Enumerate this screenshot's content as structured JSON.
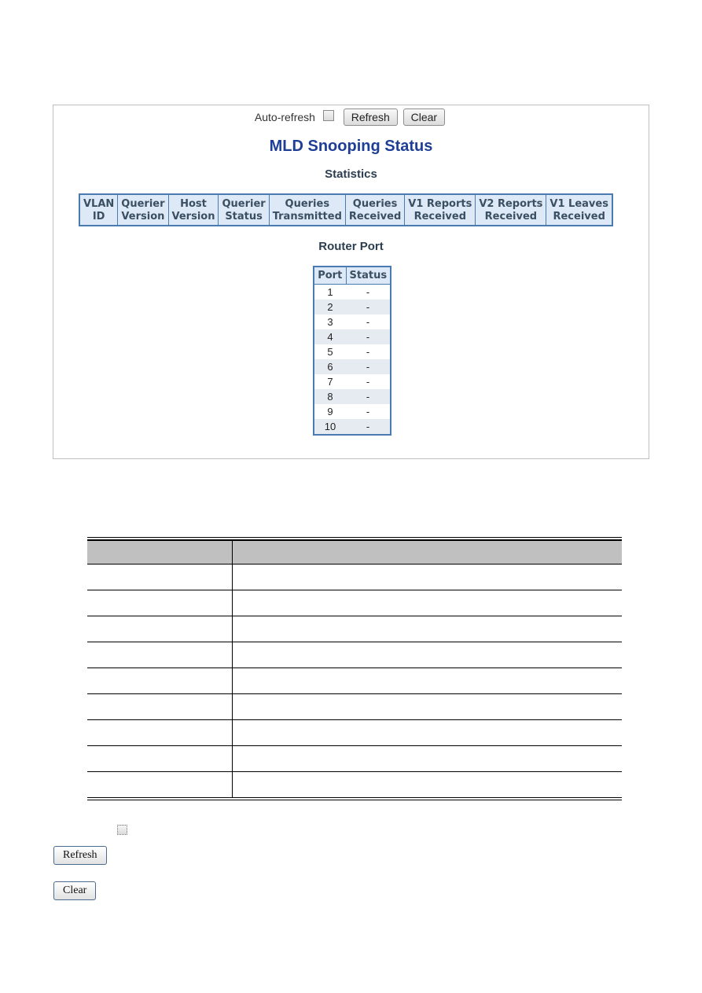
{
  "screenshot": {
    "auto_refresh_label": "Auto-refresh",
    "auto_refresh_checked": false,
    "refresh_button": "Refresh",
    "clear_button": "Clear",
    "title": "MLD Snooping Status",
    "statistics_heading": "Statistics",
    "statistics_columns": [
      [
        "VLAN",
        "ID"
      ],
      [
        "Querier",
        "Version"
      ],
      [
        "Host",
        "Version"
      ],
      [
        "Querier",
        "Status"
      ],
      [
        "Queries",
        "Transmitted"
      ],
      [
        "Queries",
        "Received"
      ],
      [
        "V1 Reports",
        "Received"
      ],
      [
        "V2 Reports",
        "Received"
      ],
      [
        "V1 Leaves",
        "Received"
      ]
    ],
    "router_port_heading": "Router Port",
    "router_port_columns": [
      "Port",
      "Status"
    ],
    "router_ports": [
      {
        "port": "1",
        "status": "-"
      },
      {
        "port": "2",
        "status": "-"
      },
      {
        "port": "3",
        "status": "-"
      },
      {
        "port": "4",
        "status": "-"
      },
      {
        "port": "5",
        "status": "-"
      },
      {
        "port": "6",
        "status": "-"
      },
      {
        "port": "7",
        "status": "-"
      },
      {
        "port": "8",
        "status": "-"
      },
      {
        "port": "9",
        "status": "-"
      },
      {
        "port": "10",
        "status": "-"
      }
    ]
  },
  "description_table": {
    "header": [
      "",
      ""
    ],
    "row_count": 9
  },
  "lower_controls": {
    "checkbox_checked": false,
    "refresh_button": "Refresh",
    "clear_button": "Clear"
  },
  "colors": {
    "title": "#1f3f96",
    "table_border": "#4a7bb0",
    "table_header_bg": "#dde9f7",
    "row_alt_bg": "#e6ebf1",
    "desc_header_bg": "#c0c0c0"
  }
}
